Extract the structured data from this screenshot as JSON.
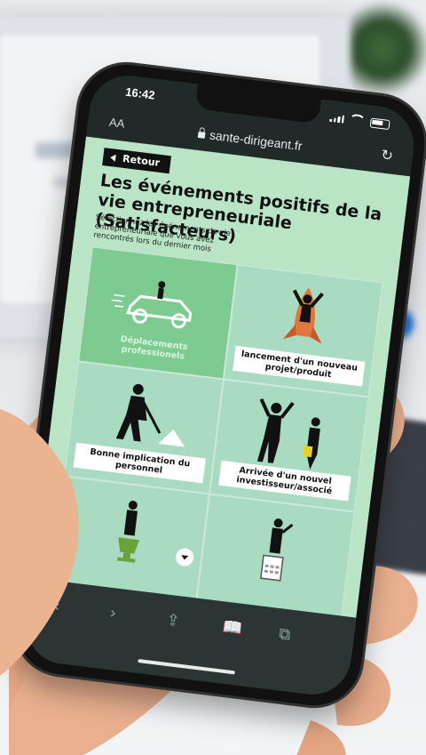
{
  "status": {
    "time": "16:42"
  },
  "browser": {
    "aa_label": "AA",
    "url": "sante-dirigeant.fr"
  },
  "page": {
    "back_label": "Retour",
    "title": "Les événements positifs de la vie entrepreneuriale (Satisfacteurs)",
    "subtitle": "Sélectionnez les événements de vie entrepreneuriale que vous avez rencontrés lors du dernier mois",
    "cards": [
      {
        "label": "Déplacements professionels",
        "selected": true,
        "icon": "car-icon"
      },
      {
        "label": "lancement d'un nouveau projet/produit",
        "selected": false,
        "icon": "rocket-icon"
      },
      {
        "label": "Bonne implication du personnel",
        "selected": false,
        "icon": "worker-shovel-icon"
      },
      {
        "label": "Arrivée d'un nouvel investisseur/associé",
        "selected": false,
        "icon": "investor-icon"
      },
      {
        "label": "",
        "selected": false,
        "icon": "trophy-icon"
      },
      {
        "label": "",
        "selected": false,
        "icon": "calculator-icon"
      }
    ]
  },
  "toolbar": {
    "back": "‹",
    "forward": "›",
    "share": "⇪",
    "bookmarks": "📖",
    "tabs": "⧉"
  },
  "colors": {
    "page_bg": "#b9e4c6",
    "selected_card": "#7ecb92",
    "card": "#a9dbc0"
  }
}
